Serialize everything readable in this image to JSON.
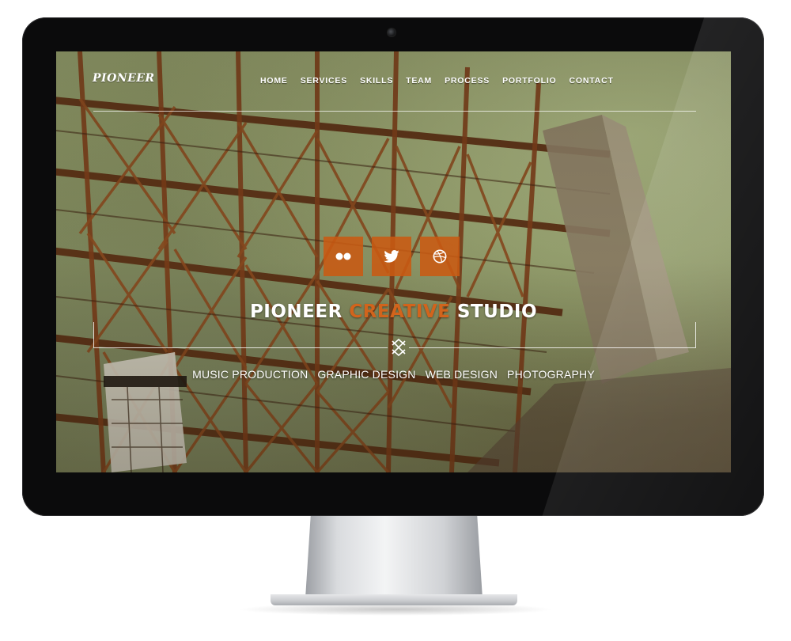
{
  "site": {
    "logo": "PIONEER",
    "nav": [
      "HOME",
      "SERVICES",
      "SKILLS",
      "TEAM",
      "PROCESS",
      "PORTFOLIO",
      "CONTACT"
    ],
    "social_icons": [
      "flickr-icon",
      "twitter-icon",
      "dribbble-icon"
    ],
    "headline": {
      "part1": "PIONEER ",
      "part2": "CREATIVE",
      "part3": " STUDIO"
    },
    "services": [
      "MUSIC PRODUCTION",
      "GRAPHIC DESIGN",
      "WEB DESIGN",
      "PHOTOGRAPHY"
    ]
  },
  "colors": {
    "accent": "#d2641c",
    "social_bg": "#ca5a12",
    "bezel": "#0b0b0c",
    "text": "#ffffff"
  }
}
